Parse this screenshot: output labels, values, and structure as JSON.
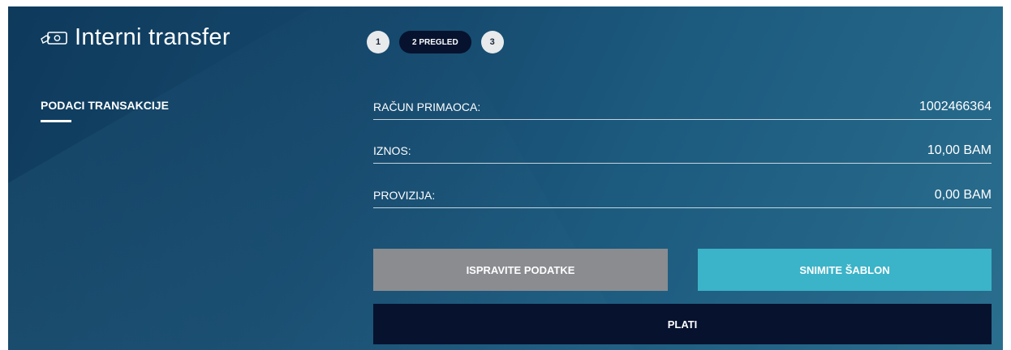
{
  "header": {
    "title": "Interni transfer",
    "icon": "money-transfer-icon"
  },
  "steps": [
    {
      "label": "1"
    },
    {
      "label": "2 PREGLED",
      "active": true
    },
    {
      "label": "3"
    }
  ],
  "section": {
    "label": "PODACI TRANSAKCIJE"
  },
  "rows": [
    {
      "label": "RAČUN PRIMAOCA:",
      "value": "1002466364"
    },
    {
      "label": "IZNOS:",
      "value": "10,00 BAM"
    },
    {
      "label": "PROVIZIJA:",
      "value": "0,00 BAM"
    }
  ],
  "buttons": {
    "edit": "ISPRAVITE PODATKE",
    "save_template": "SNIMITE ŠABLON",
    "pay": "PLATI"
  },
  "colors": {
    "panel_dark": "#0e3a5c",
    "panel_light": "#2a6e8e",
    "gray_button": "#8a8c90",
    "teal_button": "#3bb3c8",
    "navy": "#06122e"
  }
}
